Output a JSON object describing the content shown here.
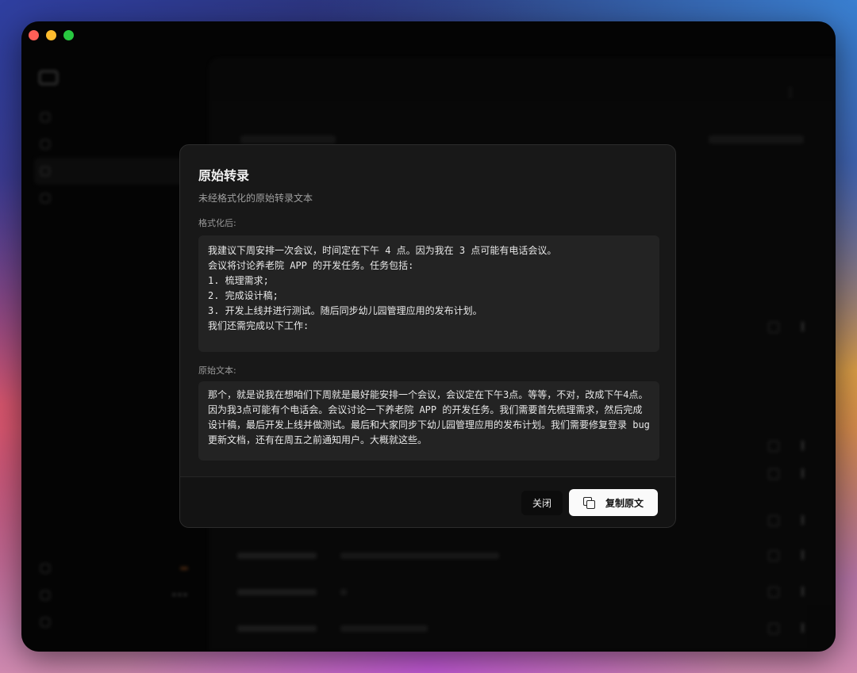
{
  "modal": {
    "title": "原始转录",
    "subtitle": "未经格式化的原始转录文本",
    "formatted_label": "格式化后:",
    "formatted_lines": [
      "我建议下周安排一次会议，时间定在下午 4 点。因为我在 3 点可能有电话会议。",
      "",
      "会议将讨论养老院 APP 的开发任务。任务包括:",
      "1. 梳理需求;",
      "2. 完成设计稿;",
      "3. 开发上线并进行测试。随后同步幼儿园管理应用的发布计划。",
      "",
      "我们还需完成以下工作:"
    ],
    "raw_label": "原始文本:",
    "raw_text": "那个，就是说我在想咱们下周就是最好能安排一个会议，会议定在下午3点。等等，不对，改成下午4点。因为我3点可能有个电话会。会议讨论一下养老院 APP 的开发任务。我们需要首先梳理需求，然后完成设计稿，最后开发上线并做测试。最后和大家同步下幼儿园管理应用的发布计划。我们需要修复登录 bug 更新文档，还有在周五之前通知用户。大概就这些。",
    "close_label": "关闭",
    "copy_label": "复制原文"
  },
  "icons": {
    "copy": "copy-icon"
  },
  "colors": {
    "modal_bg": "#181818",
    "box_bg": "#232323",
    "primary_button_bg": "#fafafa",
    "traffic_red": "#fe5f57",
    "traffic_yellow": "#febc2e",
    "traffic_green": "#28c840"
  }
}
